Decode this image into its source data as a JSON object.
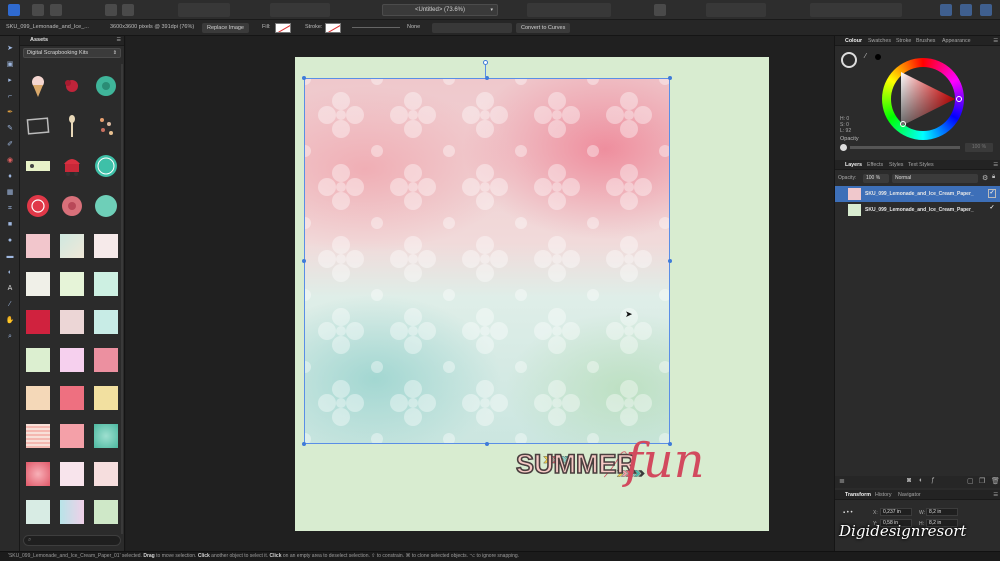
{
  "toolbar": {
    "document_title": "<Untitled> (73.6%)"
  },
  "context": {
    "layer_name": "SKU_099_Lemonade_and_Ice_...",
    "image_info": "3600x3600 pixels @ 391dpi (76%)",
    "replace_image": "Replace Image",
    "fill_label": "Fill:",
    "stroke_label": "Stroke:",
    "stroke_none": "None",
    "convert_label": "Convert to Curves"
  },
  "assets": {
    "tab_label": "Assets",
    "kit": "Digital Scrapbooking Kits"
  },
  "canvas": {
    "title_word": "SUMMER",
    "title_script": "fun"
  },
  "right_panel": {
    "top_tabs": [
      "Colour",
      "Swatches",
      "Stroke",
      "Brushes",
      "Appearance"
    ],
    "hsl": {
      "h": "H: 0",
      "s": "S: 0",
      "l": "L: 92"
    },
    "opacity_label": "Opacity",
    "opacity_value": "100 %",
    "layer_tabs": [
      "Layers",
      "Effects",
      "Styles",
      "Text Styles"
    ],
    "layer_opacity_label": "Opacity:",
    "layer_opacity": "100 %",
    "blend_mode": "Normal",
    "layers": [
      {
        "name": "SKU_099_Lemonade_and_Ice_Cream_Paper_",
        "selected": true,
        "thumb": "#f0c8cc"
      },
      {
        "name": "SKU_099_Lemonade_and_Ice_Cream_Paper_",
        "selected": false,
        "thumb": "#d8ecd0"
      }
    ],
    "bottom_tabs": [
      "Transform",
      "History",
      "Navigator"
    ],
    "transform": {
      "x_label": "X:",
      "x": "0,237 in",
      "y_label": "Y:",
      "y": "0,58 in",
      "w_label": "W:",
      "w": "8,2 in",
      "h_label": "H:",
      "h": "8,2 in"
    },
    "watermark": "Digidesignresort"
  },
  "status": {
    "selected": "'SKU_099_Lemonade_and_Ice_Cream_Paper_01' selected.",
    "drag": "Drag",
    "drag_text": " to move selection. ",
    "click": "Click",
    "click_text": " another object to select it. ",
    "click2": "Click",
    "click2_text": " on an empty area to deselect selection. ⇧ to constrain. ⌘ to clone selected objects. ⌥ to ignore snapping."
  },
  "colors": {
    "accent": "#3d6fb8",
    "selection": "#5a8ee6",
    "page_bg": "#d8ecd0",
    "title_red": "#d24a5e"
  }
}
